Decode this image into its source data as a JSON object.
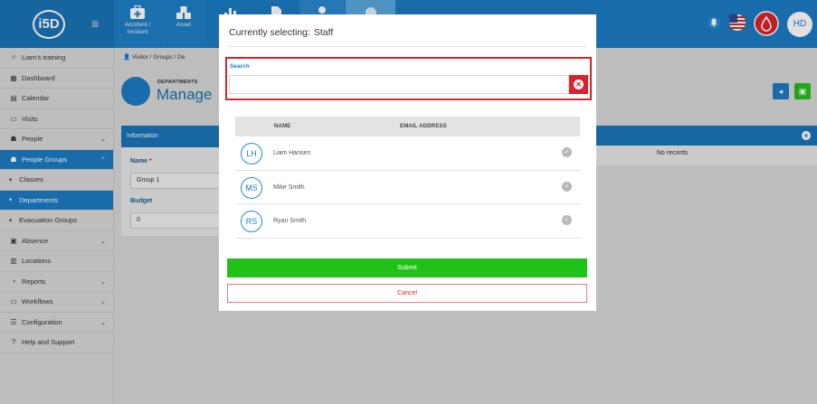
{
  "app": {
    "logo_text": "i5D",
    "menu_icon": "hamburger-icon",
    "top_tiles": [
      {
        "label": "Accident / Incident",
        "icon": "first-aid-kit-icon"
      },
      {
        "label": "Asset",
        "icon": "boxes-icon"
      },
      {
        "label": "",
        "icon": "chart-icon"
      },
      {
        "label": "",
        "icon": "document-icon"
      },
      {
        "label": "",
        "icon": "person-icon"
      },
      {
        "label": "",
        "icon": "tile-icon"
      }
    ],
    "user_initials": "HD",
    "colors": {
      "primary": "#1c7cc4",
      "danger": "#d9232d",
      "success": "#22c11a"
    }
  },
  "sidebar": {
    "items": [
      {
        "label": "Liam's training",
        "icon": "branch-icon"
      },
      {
        "label": "Dashboard",
        "icon": "dashboard-icon"
      },
      {
        "label": "Calendar",
        "icon": "calendar-icon"
      },
      {
        "label": "Visits",
        "icon": "visits-icon"
      },
      {
        "label": "People",
        "icon": "people-icon",
        "chevron": "⌄"
      },
      {
        "label": "People Groups",
        "icon": "people-groups-icon",
        "chevron": "⌃",
        "active": true
      },
      {
        "label": "Classes",
        "sub": true
      },
      {
        "label": "Departments",
        "sub": true,
        "active": true
      },
      {
        "label": "Evacuation Groups",
        "sub": true
      },
      {
        "label": "Absence",
        "icon": "absence-icon",
        "chevron": "⌄"
      },
      {
        "label": "Locations",
        "icon": "locations-icon"
      },
      {
        "label": "Reports",
        "icon": "reports-icon",
        "chevron": "⌄"
      },
      {
        "label": "Workflows",
        "icon": "workflows-icon",
        "chevron": "⌄"
      },
      {
        "label": "Configuration",
        "icon": "configuration-icon",
        "chevron": "⌄"
      },
      {
        "label": "Help and Support",
        "icon": "help-icon"
      }
    ]
  },
  "content": {
    "breadcrumb": [
      "Visitor",
      "Groups",
      "De"
    ],
    "page_pretitle": "DEPARTMENTS",
    "page_title": "Manage",
    "info_panel": {
      "title": "Information",
      "name_label": "Name",
      "required_mark": "*",
      "name_value": "Group 1",
      "budget_label": "Budget",
      "budget_value": "0"
    },
    "right_panel": {
      "empty_text": "No records"
    }
  },
  "modal": {
    "title_prefix": "Currently selecting:",
    "title_value": "Staff",
    "search": {
      "label": "Search",
      "value": "",
      "placeholder": ""
    },
    "table": {
      "headers": {
        "name": "NAME",
        "email": "EMAIL ADDRESS"
      },
      "rows": [
        {
          "initials": "LH",
          "name": "Liam Hansen",
          "email": ""
        },
        {
          "initials": "MS",
          "name": "Mike Smith",
          "email": ""
        },
        {
          "initials": "RS",
          "name": "Ryan Smith",
          "email": ""
        }
      ]
    },
    "submit_label": "Submit",
    "cancel_label": "Cancel"
  }
}
